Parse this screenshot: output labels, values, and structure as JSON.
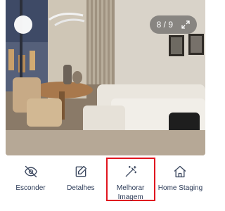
{
  "photo": {
    "alt_icon": "room-photo",
    "counter": {
      "current": "8",
      "separator": "/",
      "total": "9",
      "text": "8 / 9"
    },
    "expand_icon": "expand-icon"
  },
  "actions": [
    {
      "label": "Esconder",
      "icon": "eye-off-icon"
    },
    {
      "label": "Detalhes",
      "icon": "edit-icon"
    },
    {
      "label_line1": "Melhorar",
      "label_line2": "Imagem",
      "icon": "magic-wand-icon",
      "highlighted": true
    },
    {
      "label": "Home Staging",
      "icon": "home-icon"
    }
  ],
  "colors": {
    "highlight_border": "#e0151f",
    "label_text": "#2b3a57"
  }
}
